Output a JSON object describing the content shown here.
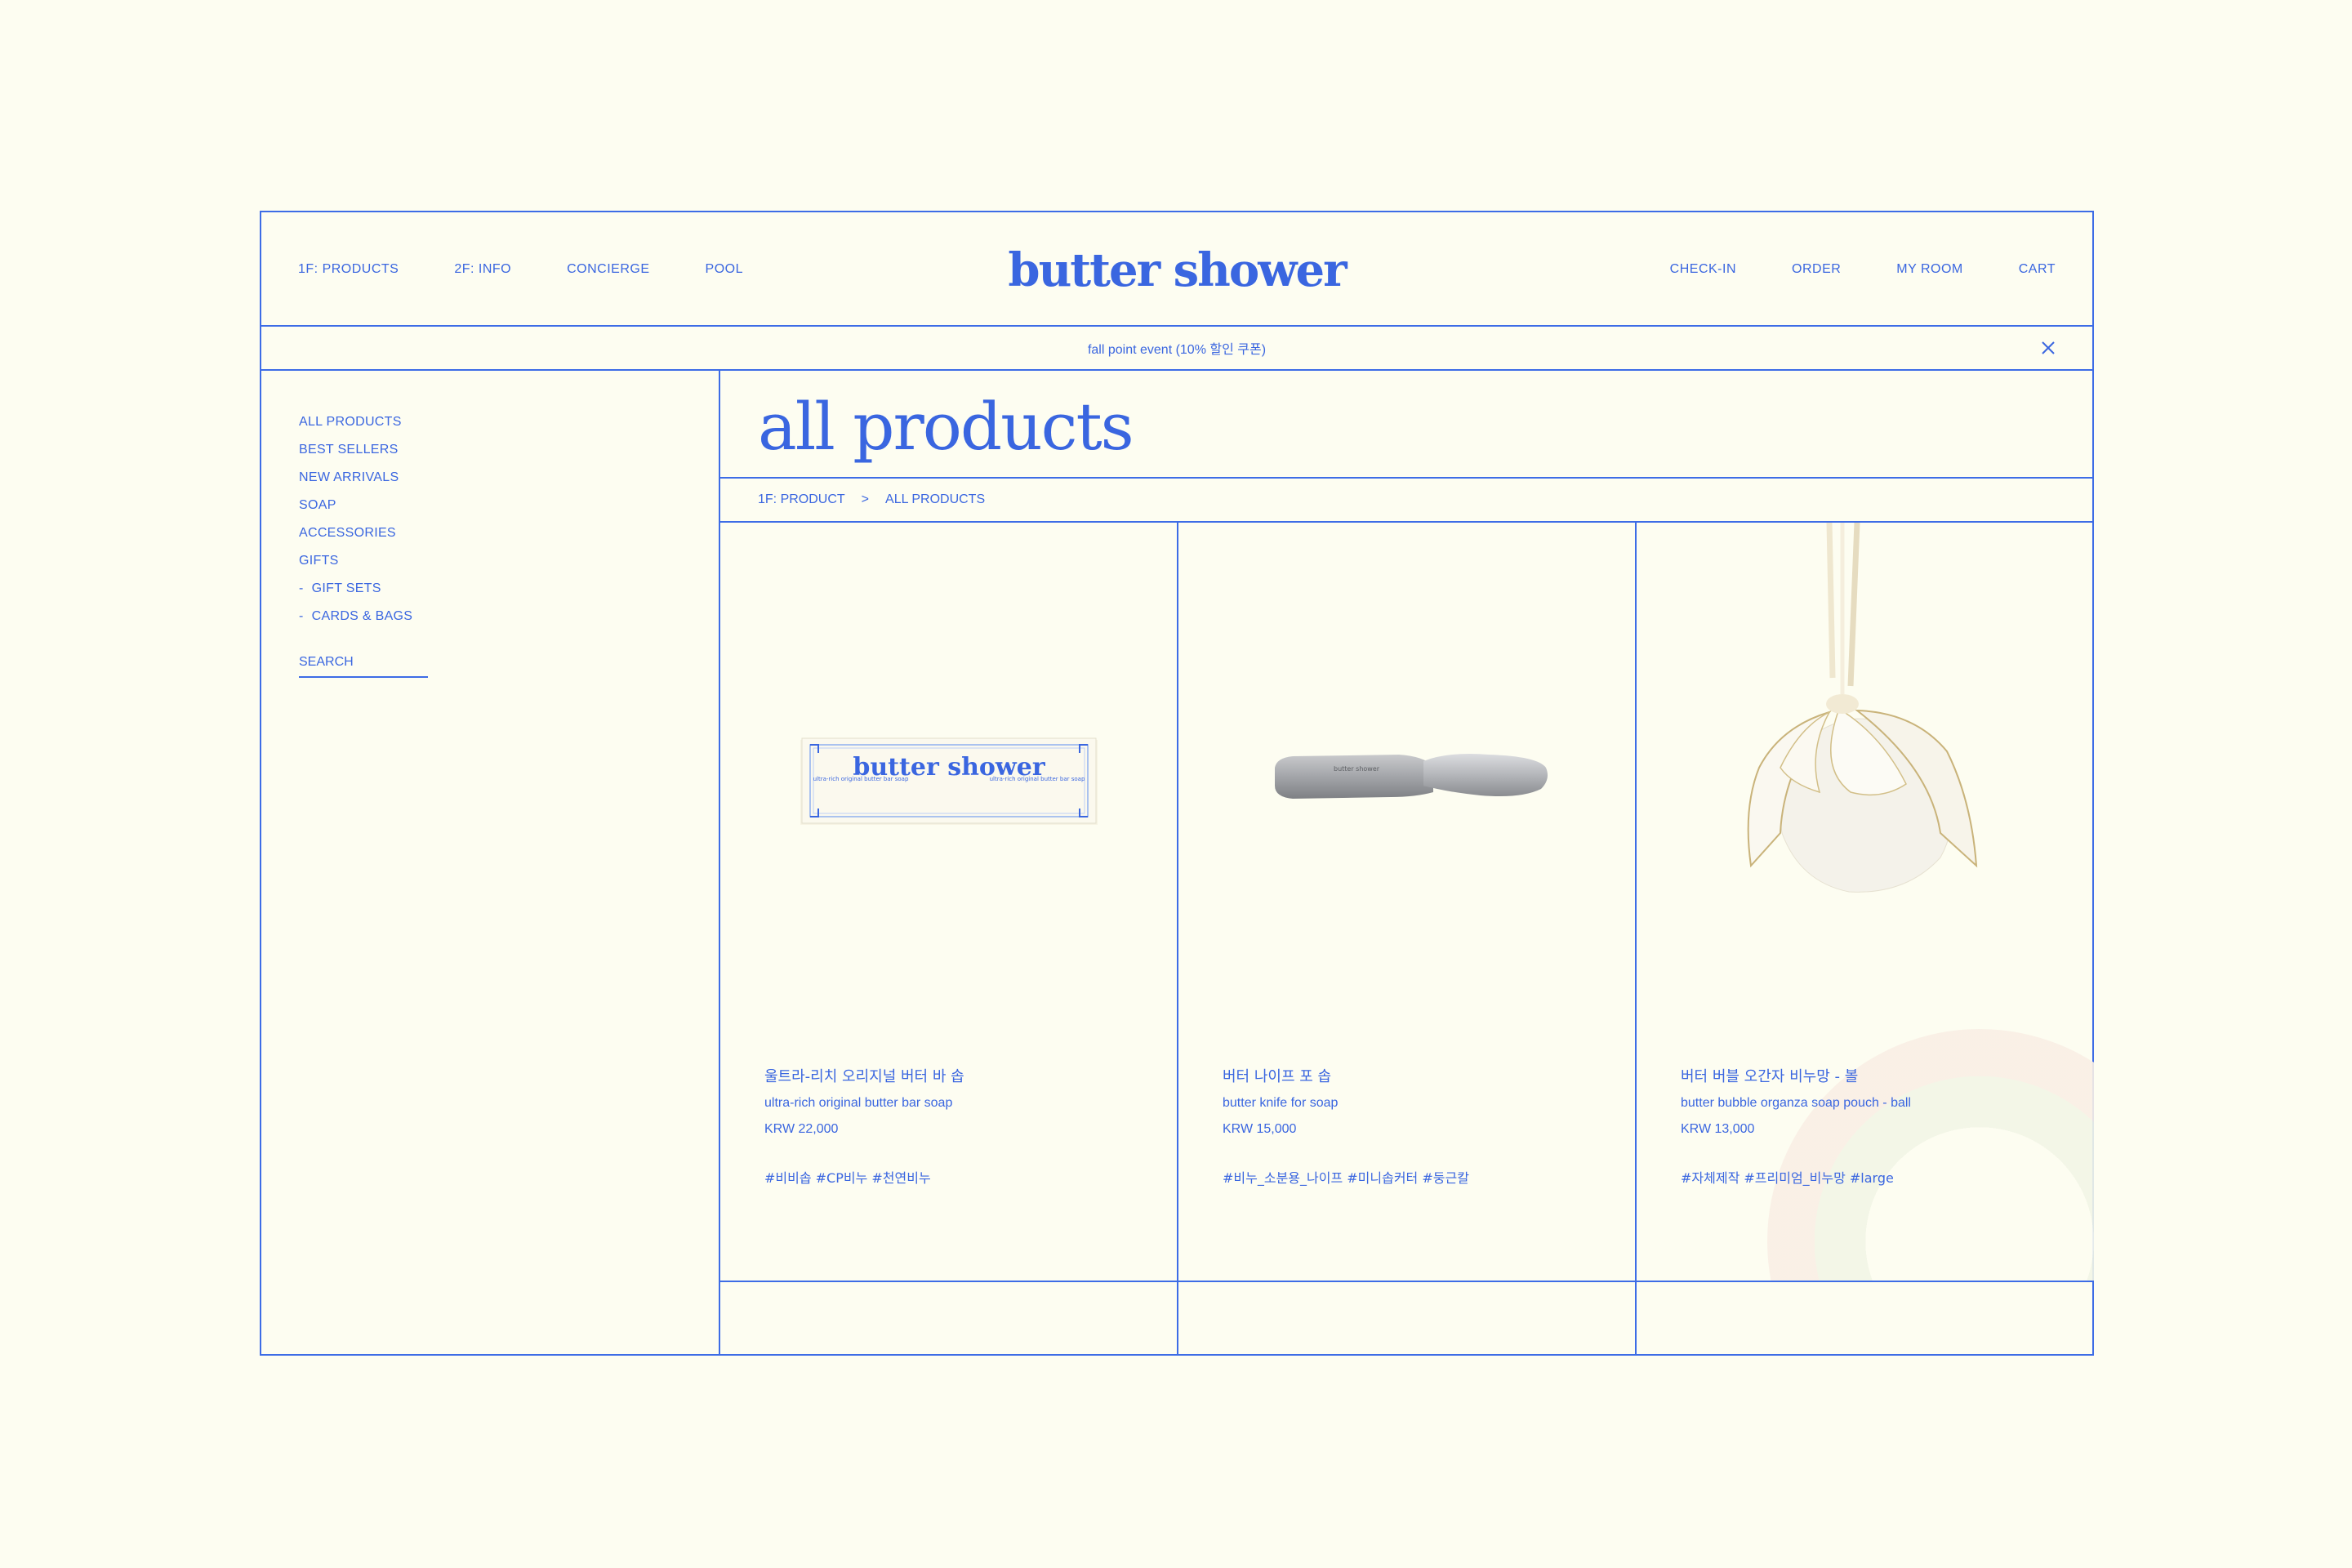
{
  "header": {
    "nav_left": [
      "1F: PRODUCTS",
      "2F: INFO",
      "CONCIERGE",
      "POOL"
    ],
    "logo": "butter shower",
    "nav_right": [
      "CHECK-IN",
      "ORDER",
      "MY ROOM",
      "CART"
    ]
  },
  "promo": {
    "text": "fall point event (10% 할인 쿠폰)",
    "close_icon": "close-icon"
  },
  "sidebar": {
    "categories": [
      "ALL PRODUCTS",
      "BEST SELLERS",
      "NEW ARRIVALS",
      "SOAP",
      "ACCESSORIES",
      "GIFTS",
      "GIFT SETS",
      "CARDS & BAGS"
    ],
    "search_placeholder": "SEARCH"
  },
  "main": {
    "title": "all products",
    "breadcrumb": [
      "1F: PRODUCT",
      "ALL PRODUCTS"
    ],
    "breadcrumb_sep": ">",
    "products": [
      {
        "name_ko": "울트라-리치 오리지널 버터 바 솝",
        "name_en": "ultra-rich original butter bar soap",
        "price": "KRW 22,000",
        "tags": "#비비솝 #CP비누 #천연비누",
        "box_brand": "butter shower",
        "box_left_text": "ultra-rich original butter bar soap",
        "box_right_text": "ultra-rich original butter bar soap"
      },
      {
        "name_ko": "버터 나이프 포 솝",
        "name_en": "butter knife for soap",
        "price": "KRW 15,000",
        "tags": "#비누_소분용_나이프 #미니솝커터 #둥근칼",
        "blade_text": "butter shower"
      },
      {
        "name_ko": "버터 버블 오간자 비누망 - 볼",
        "name_en": "butter bubble organza soap pouch - ball",
        "price": "KRW 13,000",
        "tags": "#자체제작 #프리미엄_비누망 #large"
      }
    ]
  },
  "colors": {
    "accent": "#3a66e0",
    "background": "#fdfdf1"
  }
}
